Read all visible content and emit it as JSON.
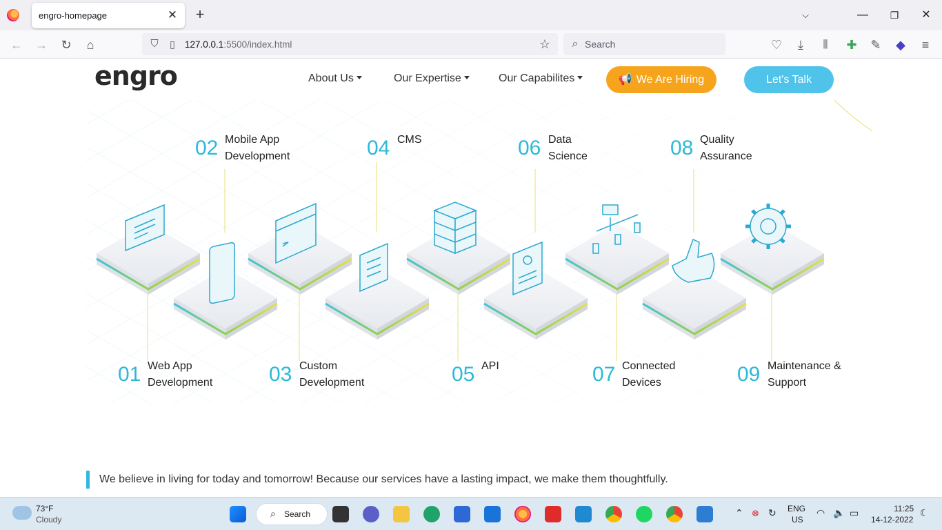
{
  "browser": {
    "tab_title": "engro-homepage",
    "url_host": "127.0.0.1",
    "url_rest": ":5500/index.html",
    "search_placeholder": "Search"
  },
  "site": {
    "logo": "engro",
    "menu": [
      "About Us",
      "Our Expertise",
      "Our Capabilites"
    ],
    "hiring_label": "We Are Hiring",
    "talk_label": "Let's Talk",
    "services": [
      {
        "num": "01",
        "title": "Web App\nDevelopment"
      },
      {
        "num": "02",
        "title": "Mobile App\nDevelopment"
      },
      {
        "num": "03",
        "title": "Custom\nDevelopment"
      },
      {
        "num": "04",
        "title": "CMS"
      },
      {
        "num": "05",
        "title": "API"
      },
      {
        "num": "06",
        "title": "Data\nScience"
      },
      {
        "num": "07",
        "title": "Connected\nDevices"
      },
      {
        "num": "08",
        "title": "Quality\nAssurance"
      },
      {
        "num": "09",
        "title": "Maintenance &\nSupport"
      }
    ],
    "tagline": "We believe in living for today and tomorrow! Because our services have a lasting impact, we make them thoughtfully."
  },
  "taskbar": {
    "weather_temp": "73°F",
    "weather_desc": "Cloudy",
    "search_label": "Search",
    "lang": "ENG",
    "region": "US",
    "time": "11:25",
    "date": "14-12-2022"
  },
  "colors": {
    "accent_cyan": "#2cb9d8",
    "hire_orange": "#f7a41d",
    "talk_blue": "#4fc3ea",
    "stripe_green": "#8fd14f",
    "stripe_yellow": "#e6e04a"
  }
}
